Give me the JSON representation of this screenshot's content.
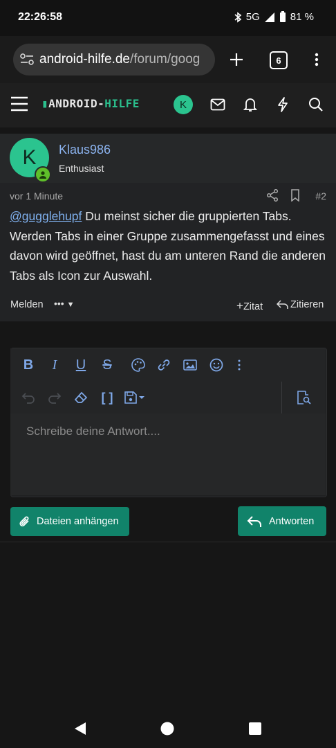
{
  "status": {
    "time": "22:26:58",
    "network": "5G",
    "battery": "81 %"
  },
  "browser": {
    "url_host": "android-hilfe.de",
    "url_path": "/forum/goog",
    "tab_count": "6"
  },
  "site": {
    "logo_part1": "ANDROID-",
    "logo_part2": "HILFE",
    "avatar_letter": "K"
  },
  "post": {
    "avatar_letter": "K",
    "username": "Klaus986",
    "user_title": "Enthusiast",
    "time": "vor 1 Minute",
    "number": "#2",
    "mention": "@gugglehupf",
    "text": " Du meinst sicher die gruppierten Tabs. Werden Tabs in einer Gruppe zusammengefasst und eines davon wird geöffnet, hast du am unteren Rand die anderen Tabs als Icon zur Auswahl.",
    "report_label": "Melden",
    "more_label": "•••",
    "quote_label": "Zitat",
    "reply_quote_label": "Zitieren"
  },
  "editor": {
    "placeholder": "Schreibe deine Antwort....",
    "attach_label": "Dateien anhängen",
    "submit_label": "Antworten"
  },
  "colors": {
    "accent": "#11836a",
    "link": "#7fb0ee",
    "avatar": "#2bc48f"
  }
}
